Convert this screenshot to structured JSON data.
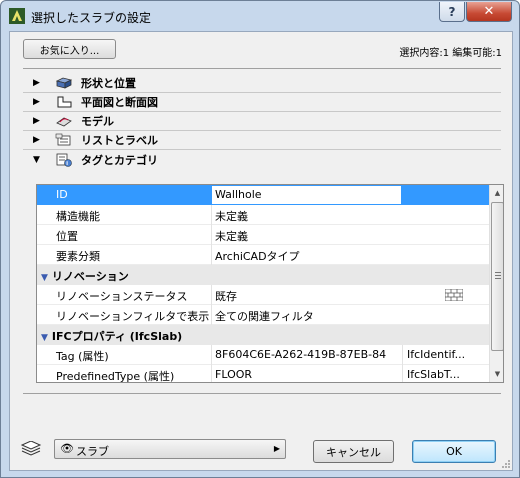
{
  "window": {
    "title": "選択したスラブの設定",
    "help_label": "?",
    "close_label": "✕"
  },
  "toolbar": {
    "favorites_label": "お気に入り...",
    "selection_info": "選択内容:1 編集可能:1"
  },
  "panels": [
    {
      "label": "形状と位置",
      "expanded": false,
      "icon": "slab-geometry-icon"
    },
    {
      "label": "平面図と断面図",
      "expanded": false,
      "icon": "floor-plan-section-icon"
    },
    {
      "label": "モデル",
      "expanded": false,
      "icon": "model-icon"
    },
    {
      "label": "リストとラベル",
      "expanded": false,
      "icon": "list-label-icon"
    },
    {
      "label": "タグとカテゴリ",
      "expanded": true,
      "icon": "tag-category-icon"
    }
  ],
  "grid": {
    "rows": [
      {
        "type": "item",
        "name": "ID",
        "value": "Wallhole",
        "extra": "",
        "selected": true
      },
      {
        "type": "item",
        "name": "構造機能",
        "value": "未定義",
        "extra": ""
      },
      {
        "type": "item",
        "name": "位置",
        "value": "未定義",
        "extra": ""
      },
      {
        "type": "item",
        "name": "要素分類",
        "value": "ArchiCADタイプ",
        "extra": ""
      },
      {
        "type": "group",
        "name": "リノベーション"
      },
      {
        "type": "item",
        "name": "リノベーションステータス",
        "value": "既存",
        "extra": ""
      },
      {
        "type": "item",
        "name": "リノベーションフィルタで表示",
        "value": "全ての関連フィルタ",
        "extra": ""
      },
      {
        "type": "group",
        "name": "IFCプロパティ (IfcSlab)"
      },
      {
        "type": "item",
        "name": "Tag (属性)",
        "value": "8F604C6E-A262-419B-87EB-84",
        "extra": "IfcIdentif..."
      },
      {
        "type": "item",
        "name": "PredefinedType (属性)",
        "value": "FLOOR",
        "extra": "IfcSlabT..."
      }
    ]
  },
  "footer": {
    "layer_value": "スラブ",
    "cancel_label": "キャンセル",
    "ok_label": "OK"
  },
  "colors": {
    "selection": "#3399ff",
    "frame": "#c7d8ec",
    "close_button": "#c74a34"
  }
}
